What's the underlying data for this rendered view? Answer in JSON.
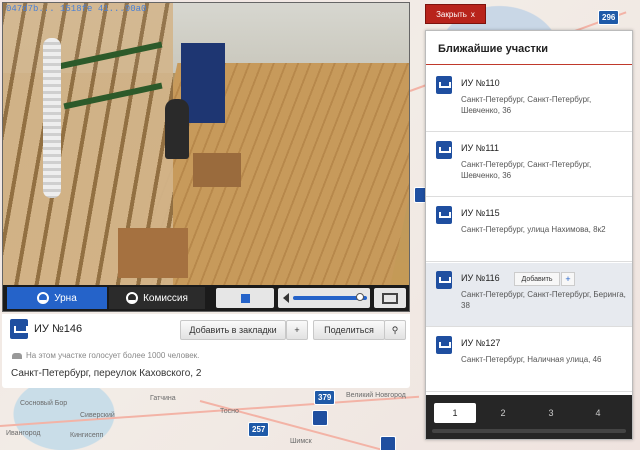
{
  "camera": {
    "id": "047d7b... 1518fe 41...90a0"
  },
  "video_controls": {
    "tab_urn": "Урна",
    "tab_commission": "Комиссия",
    "volume_level": 0.95
  },
  "info": {
    "title": "ИУ №146",
    "bookmark_label": "Добавить в закладки",
    "bookmark_plus": "+",
    "share_label": "Поделиться",
    "note": "На этом участке голосует более 1000 человек.",
    "address": "Санкт-Петербург, переулок Каховского, 2"
  },
  "close_button": {
    "label": "Закрыть",
    "x": "x"
  },
  "nearby": {
    "header": "Ближайшие участки",
    "add_label": "Добавить",
    "add_plus": "+",
    "items": [
      {
        "title": "ИУ №110",
        "address": "Санкт-Петербург, Санкт-Петербург, Шевченко, 36"
      },
      {
        "title": "ИУ №111",
        "address": "Санкт-Петербург, Санкт-Петербург, Шевченко, 36"
      },
      {
        "title": "ИУ №115",
        "address": "Санкт-Петербург, улица Нахимова, 8к2"
      },
      {
        "title": "ИУ №116",
        "address": "Санкт-Петербург, Санкт-Петербург, Беринга, 38"
      },
      {
        "title": "ИУ №127",
        "address": "Санкт-Петербург, Наличная улица, 46"
      }
    ],
    "pages": [
      "1",
      "2",
      "3",
      "4"
    ],
    "active_page": "1"
  },
  "map": {
    "badges": [
      "296",
      "379",
      "257"
    ],
    "labels": [
      "Великий Новгород",
      "Сосновый Бор",
      "Гатчина",
      "Сиверский",
      "Ивангород",
      "Кингисепп",
      "Тосно",
      "Шимск"
    ]
  }
}
